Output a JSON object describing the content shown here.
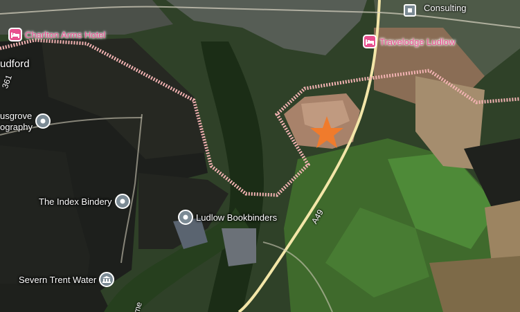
{
  "map": {
    "places": {
      "charlton_arms": "Charlton Arms Hotel",
      "travelodge": "Travelodge Ludlow",
      "musgrove": "usgrove\nography",
      "index_bindery": "The Index Bindery",
      "ludlow_bookbinders": "Ludlow Bookbinders",
      "severn_trent": "Severn Trent Water",
      "ludford": "udford",
      "consulting": "Consulting"
    },
    "roads": {
      "a49": "A49",
      "b4361": "361",
      "bottom_road": "me"
    },
    "icons": {
      "hotel": "hotel-icon",
      "place": "place-pin-icon",
      "museum": "landmark-icon",
      "marker": "star-marker-icon"
    },
    "colors": {
      "boundary": "#f3b3b3",
      "marker": "#f07b2c",
      "poi_pink": "#e8508f",
      "poi_grey": "#7b8a94",
      "road": "#f3e6a8"
    }
  }
}
